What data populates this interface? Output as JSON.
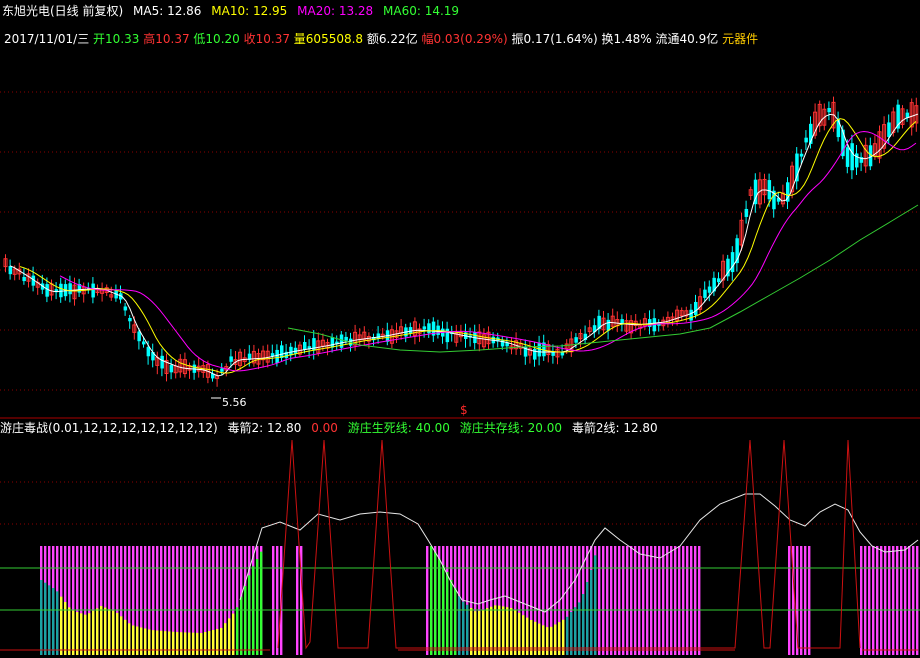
{
  "colors": {
    "background": "#000000",
    "grid": "#8b0000",
    "ma5": "#ffffff",
    "ma10": "#ffff00",
    "ma20": "#ff00ff",
    "ma60": "#33cc33",
    "candle_up": "#ff3333",
    "candle_down": "#00ffff",
    "bar_magenta": "#ff44ff",
    "bar_cyan": "#1aa3a3",
    "bar_yellow": "#ffff33",
    "bar_green": "#33ff33",
    "signal_red": "#cc1111",
    "ref_line_green": "#33cc33"
  },
  "header": {
    "title": "东旭光电(日线 前复权)",
    "ma5_label": "MA5: 12.86",
    "ma10_label": "MA10: 12.95",
    "ma20_label": "MA20: 13.28",
    "ma60_label": "MA60: 14.19"
  },
  "quote": {
    "date": "2017/11/01/三",
    "open": "开10.33",
    "high": "高10.37",
    "low": "低10.20",
    "close": "收10.37",
    "volume": "量605508.8",
    "amount": "额6.22亿",
    "change": "幅0.03(0.29%)",
    "amplitude": "振0.17(1.64%)",
    "turnover": "换1.48%",
    "float_cap": "流通40.9亿",
    "sector": "元器件"
  },
  "price_chart": {
    "low_marker": "5.56",
    "event_marker": "$"
  },
  "indicator": {
    "name": "游庄毒战(0.01,12,12,12,12,12,12,12)",
    "arrow_label": "毒箭2: 12.80",
    "arrow_value": "0.00",
    "life_line": "游庄生死线: 40.00",
    "coexist_line": "游庄共存线: 20.00",
    "arrow2_label": "毒箭2线: 12.80"
  }
}
